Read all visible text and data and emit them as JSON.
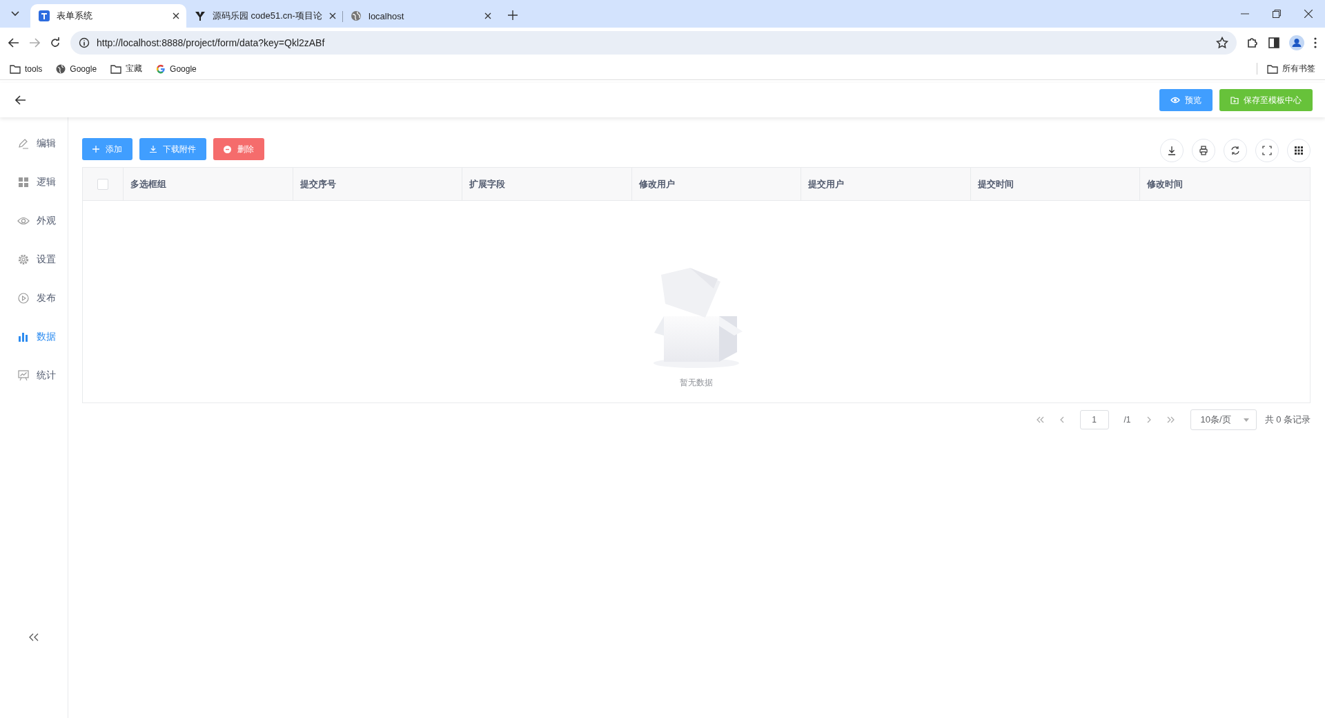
{
  "browser": {
    "tabs": [
      {
        "title": "表单系统",
        "selected": true
      },
      {
        "title": "源码乐园 code51.cn-项目论",
        "selected": false
      },
      {
        "title": "localhost",
        "selected": false
      }
    ],
    "address": "http://localhost:8888/project/form/data?key=Qkl2zABf",
    "bookmarks": [
      {
        "label": "tools",
        "kind": "folder"
      },
      {
        "label": "Google",
        "kind": "globe"
      },
      {
        "label": "宝藏",
        "kind": "folder"
      },
      {
        "label": "Google",
        "kind": "google"
      }
    ],
    "all_bookmarks": "所有书签"
  },
  "header": {
    "buttons": [
      {
        "label": "预览",
        "kind": "preview"
      },
      {
        "label": "保存至模板中心",
        "kind": "save"
      }
    ]
  },
  "sidebar": {
    "items": [
      {
        "label": "编辑",
        "kind": "edit",
        "selected": false
      },
      {
        "label": "逻辑",
        "kind": "logic",
        "selected": false
      },
      {
        "label": "外观",
        "kind": "look",
        "selected": false
      },
      {
        "label": "设置",
        "kind": "settings",
        "selected": false
      },
      {
        "label": "发布",
        "kind": "publish",
        "selected": false
      },
      {
        "label": "数据",
        "kind": "data",
        "selected": true
      },
      {
        "label": "统计",
        "kind": "stats",
        "selected": false
      }
    ]
  },
  "toolbar": {
    "buttons": [
      {
        "label": "添加",
        "kind": "add"
      },
      {
        "label": "下载附件",
        "kind": "download"
      },
      {
        "label": "删除",
        "kind": "delete"
      }
    ]
  },
  "table": {
    "select_all": {
      "checked": false
    },
    "columns": [
      "多选框组",
      "提交序号",
      "扩展字段",
      "修改用户",
      "提交用户",
      "提交时间",
      "修改时间"
    ],
    "empty_text": "暂无数据"
  },
  "pagination": {
    "page": "1",
    "total_pages": "/1",
    "page_size": "10条/页",
    "total": "共 0 条记录"
  }
}
